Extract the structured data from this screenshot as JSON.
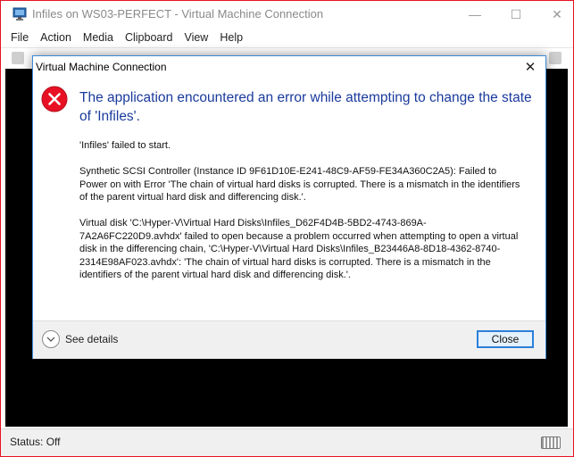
{
  "window": {
    "title": "Infiles on WS03-PERFECT - Virtual Machine Connection",
    "minimize_glyph": "—",
    "maximize_glyph": "☐",
    "close_glyph": "✕"
  },
  "menu": {
    "items": [
      "File",
      "Action",
      "Media",
      "Clipboard",
      "View",
      "Help"
    ]
  },
  "statusbar": {
    "status": "Status: Off",
    "icon": "keyboard-icon"
  },
  "dialog": {
    "title": "Virtual Machine Connection",
    "close_glyph": "✕",
    "icon": "error-icon",
    "error_color": "#e81123",
    "main_instruction": "The application encountered an error while attempting to change the state of 'Infiles'.",
    "paragraphs": [
      "'Infiles' failed to start.",
      "Synthetic SCSI Controller (Instance ID 9F61D10E-E241-48C9-AF59-FE34A360C2A5): Failed to Power on with Error 'The chain of virtual hard disks is corrupted. There is a mismatch in the identifiers of the parent virtual hard disk and differencing disk.'.",
      "Virtual disk 'C:\\Hyper-V\\Virtual Hard Disks\\Infiles_D62F4D4B-5BD2-4743-869A-7A2A6FC220D9.avhdx' failed to open because a problem occurred when attempting to open a virtual disk in the differencing chain, 'C:\\Hyper-V\\Virtual Hard Disks\\Infiles_B23446A8-8D18-4362-8740-2314E98AF023.avhdx': 'The chain of virtual hard disks is corrupted. There is a mismatch in the identifiers of the parent virtual hard disk and differencing disk.'."
    ],
    "see_details_label": "See details",
    "close_button_label": "Close"
  },
  "colors": {
    "accent": "#2c7fd9",
    "instruction_text": "#1a3a9c",
    "vm_background": "#000000"
  }
}
